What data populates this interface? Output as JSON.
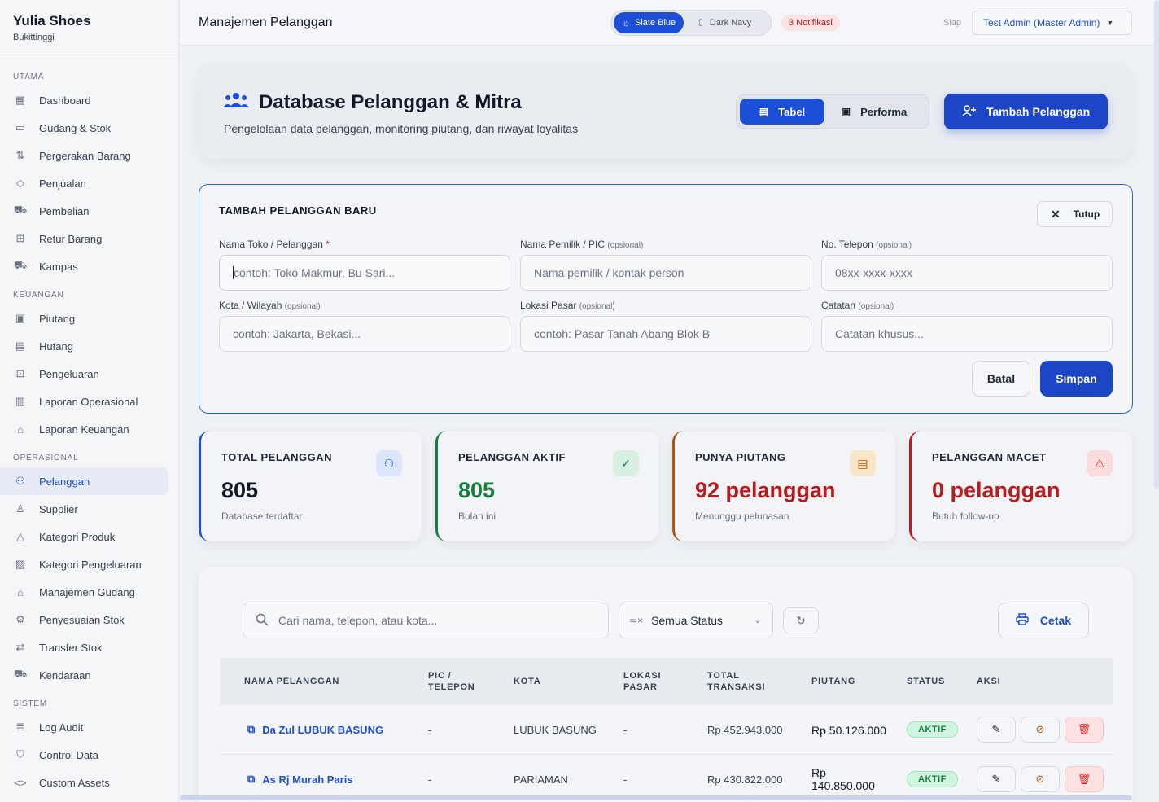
{
  "brand": {
    "name": "Yulia Shoes",
    "sub": "Bukittinggi"
  },
  "sidebar": {
    "sections": [
      {
        "label": "UTAMA",
        "items": [
          {
            "label": "Dashboard",
            "icon": "dashboard-icon"
          },
          {
            "label": "Gudang & Stok",
            "icon": "archive-icon"
          },
          {
            "label": "Pergerakan Barang",
            "icon": "arrows-icon"
          },
          {
            "label": "Penjualan",
            "icon": "tag-icon"
          },
          {
            "label": "Pembelian",
            "icon": "cart-icon"
          },
          {
            "label": "Retur Barang",
            "icon": "return-box-icon"
          },
          {
            "label": "Kampas",
            "icon": "truck-icon"
          }
        ]
      },
      {
        "label": "KEUANGAN",
        "items": [
          {
            "label": "Piutang",
            "icon": "wallet-icon"
          },
          {
            "label": "Hutang",
            "icon": "money-icon"
          },
          {
            "label": "Pengeluaran",
            "icon": "receipt-icon"
          },
          {
            "label": "Laporan Operasional",
            "icon": "bar-report-icon"
          },
          {
            "label": "Laporan Keuangan",
            "icon": "bank-icon"
          }
        ]
      },
      {
        "label": "OPERASIONAL",
        "items": [
          {
            "label": "Pelanggan",
            "icon": "users-icon",
            "active": true
          },
          {
            "label": "Supplier",
            "icon": "dolly-icon"
          },
          {
            "label": "Kategori Produk",
            "icon": "shapes-icon"
          },
          {
            "label": "Kategori Pengeluaran",
            "icon": "chart-icon"
          },
          {
            "label": "Manajemen Gudang",
            "icon": "warehouse-icon"
          },
          {
            "label": "Penyesuaian Stok",
            "icon": "cog-icon"
          },
          {
            "label": "Transfer Stok",
            "icon": "transfer-icon"
          },
          {
            "label": "Kendaraan",
            "icon": "truck-icon"
          }
        ]
      },
      {
        "label": "SISTEM",
        "items": [
          {
            "label": "Log Audit",
            "icon": "log-icon"
          },
          {
            "label": "Control Data",
            "icon": "shield-icon"
          },
          {
            "label": "Custom Assets",
            "icon": "code-icon"
          }
        ]
      }
    ]
  },
  "topbar": {
    "title": "Manajemen Pelanggan",
    "theme_light": "Slate Blue",
    "theme_dark": "Dark Navy",
    "notif": "3 Notifikasi",
    "status": "Siap",
    "user": "Test Admin (Master Admin)"
  },
  "hero": {
    "title": "Database Pelanggan & Mitra",
    "subtitle": "Pengelolaan data pelanggan, monitoring piutang, dan riwayat loyalitas",
    "view_table": "Tabel",
    "view_perf": "Performa",
    "add": "Tambah Pelanggan"
  },
  "form": {
    "title": "TAMBAH PELANGGAN BARU",
    "close": "Tutup",
    "optional": "(opsional)",
    "fields": {
      "nama": {
        "label": "Nama Toko / Pelanggan",
        "req": "*",
        "placeholder": "contoh: Toko Makmur, Bu Sari..."
      },
      "pic": {
        "label": "Nama Pemilik / PIC",
        "placeholder": "Nama pemilik / kontak person"
      },
      "telp": {
        "label": "No. Telepon",
        "placeholder": "08xx-xxxx-xxxx"
      },
      "kota": {
        "label": "Kota / Wilayah",
        "placeholder": "contoh: Jakarta, Bekasi..."
      },
      "pasar": {
        "label": "Lokasi Pasar",
        "placeholder": "contoh: Pasar Tanah Abang Blok B"
      },
      "catatan": {
        "label": "Catatan",
        "placeholder": "Catatan khusus..."
      }
    },
    "cancel": "Batal",
    "save": "Simpan"
  },
  "stats": [
    {
      "label": "TOTAL PELANGGAN",
      "value": "805",
      "sub": "Database terdaftar",
      "color": "#1d4ed8",
      "icon": "users-icon"
    },
    {
      "label": "PELANGGAN AKTIF",
      "value": "805",
      "sub": "Bulan ini",
      "color": "#15803d",
      "icon": "check-circle-icon"
    },
    {
      "label": "PUNYA PIUTANG",
      "value": "92 pelanggan",
      "sub": "Menunggu pelunasan",
      "color": "#b91c1c",
      "icon": "money-icon"
    },
    {
      "label": "PELANGGAN MACET",
      "value": "0 pelanggan",
      "sub": "Butuh follow-up",
      "color": "#b91c1c",
      "icon": "warning-icon"
    }
  ],
  "table": {
    "search_placeholder": "Cari nama, telepon, atau kota...",
    "filter": "Semua Status",
    "print": "Cetak",
    "headers": [
      "NAMA PELANGGAN",
      "PIC /\nTELEPON",
      "KOTA",
      "LOKASI\nPASAR",
      "TOTAL\nTRANSAKSI",
      "PIUTANG",
      "STATUS",
      "AKSI"
    ],
    "rows": [
      {
        "name": "Da Zul LUBUK BASUNG",
        "pic": "-",
        "kota": "LUBUK BASUNG",
        "pasar": "-",
        "total": "Rp 452.943.000",
        "piutang": "Rp 50.126.000",
        "status": "AKTIF"
      },
      {
        "name": "As Rj Murah Paris",
        "pic": "-",
        "kota": "PARIAMAN",
        "pasar": "-",
        "total": "Rp 430.822.000",
        "piutang": "Rp\n140.850.000",
        "status": "AKTIF"
      }
    ]
  }
}
